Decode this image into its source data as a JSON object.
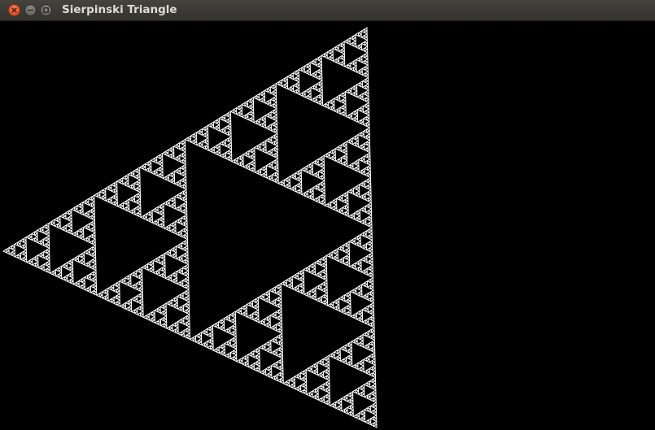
{
  "window": {
    "title": "Sierpinski Triangle",
    "background": "#000000",
    "titlebar_color": "#3c3b37",
    "buttons": [
      {
        "name": "close",
        "icon": "close-icon",
        "color": "#e9653b"
      },
      {
        "name": "minimize",
        "icon": "minimize-icon",
        "color": "#7c7a75"
      },
      {
        "name": "maximize",
        "icon": "maximize-icon",
        "color": "#7c7a75"
      }
    ]
  },
  "fractal": {
    "name": "sierpinski-triangle",
    "stroke_color": "#ffffff",
    "fill_color": "#000000"
  }
}
